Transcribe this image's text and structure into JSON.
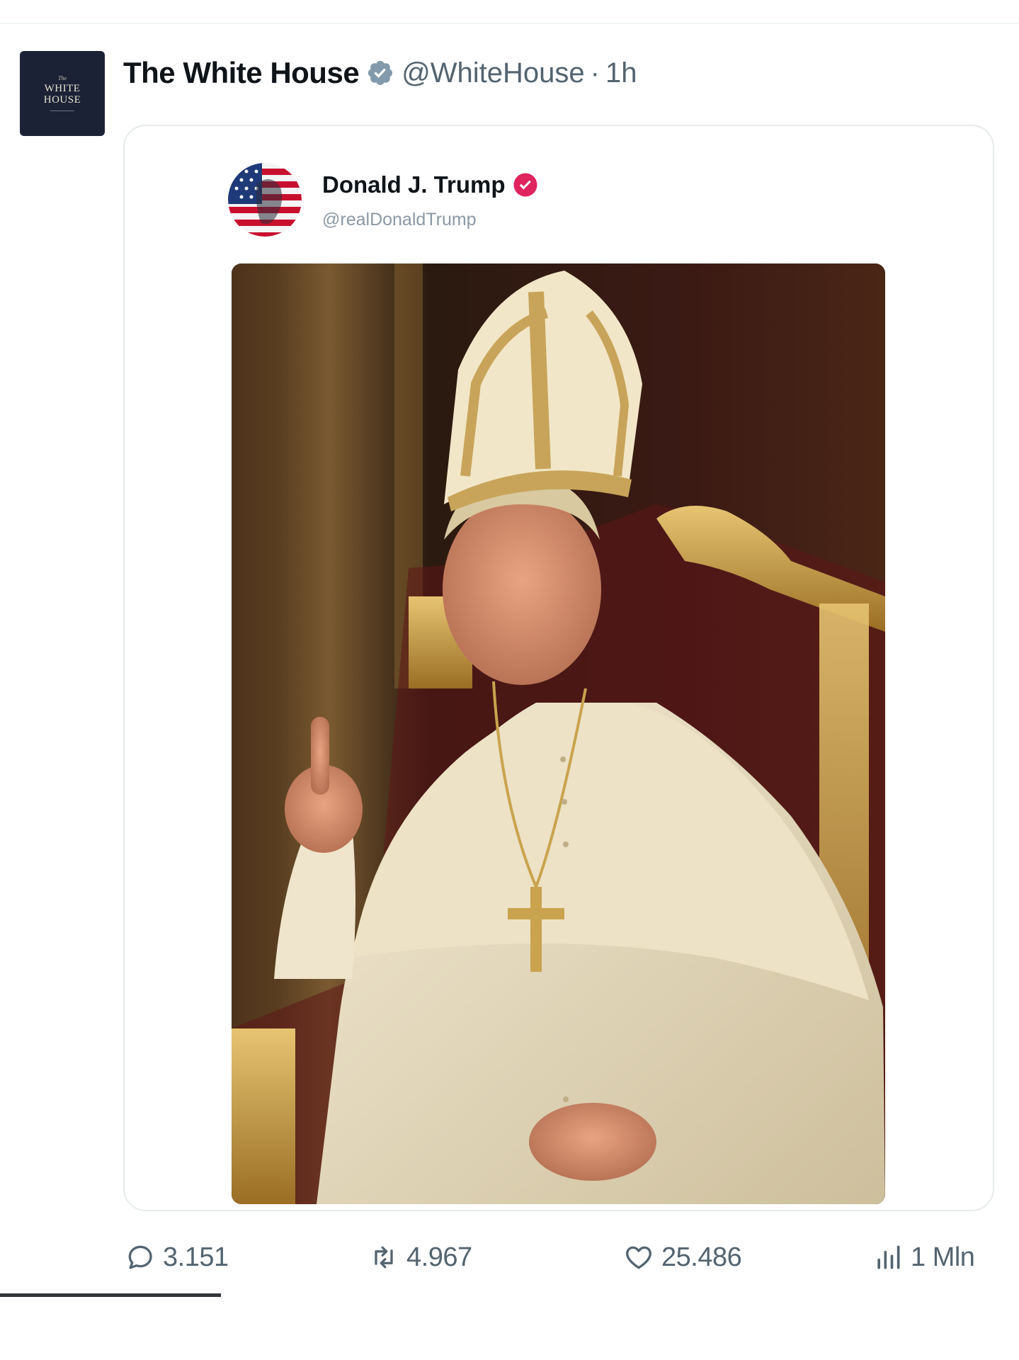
{
  "post": {
    "author_name": "The White House",
    "author_handle": "@WhiteHouse",
    "separator": "·",
    "time": "1h",
    "avatar": {
      "line_top": "The",
      "line1": "WHITE",
      "line2": "HOUSE"
    }
  },
  "quoted": {
    "author_name": "Donald J. Trump",
    "author_handle": "@realDonaldTrump"
  },
  "actions": {
    "replies": "3.151",
    "reposts": "4.967",
    "likes": "25.486",
    "views": "1 Mln"
  },
  "icons": {
    "verified": "verified-badge-icon",
    "reply": "reply-icon",
    "repost": "repost-icon",
    "like": "heart-icon",
    "views": "views-chart-icon"
  },
  "colors": {
    "verified_blue": "#1d9bf0",
    "verified_gov": "#829aab",
    "badge_pink": "#e0245e",
    "text_secondary": "#536471",
    "avatar_navy": "#1c2236"
  }
}
